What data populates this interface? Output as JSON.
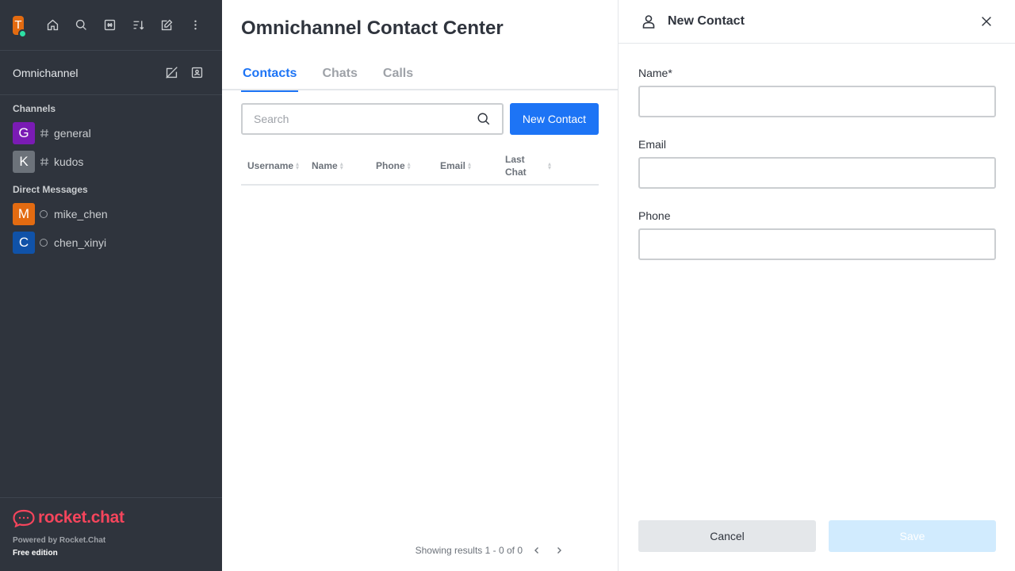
{
  "sidebar": {
    "user_initial": "T",
    "colors": {
      "user_avatar": "#e36b11",
      "status_online": "#2de0a5"
    },
    "top_icons": [
      "home-icon",
      "search-icon",
      "directory-icon",
      "sort-icon",
      "create-new-icon",
      "kebab-menu-icon"
    ],
    "omnichannel_label": "Omnichannel",
    "channels_title": "Channels",
    "channels": [
      {
        "initial": "G",
        "name": "general",
        "color": "#7a1bb4"
      },
      {
        "initial": "K",
        "name": "kudos",
        "color": "#6c727a"
      }
    ],
    "dm_title": "Direct Messages",
    "direct_messages": [
      {
        "initial": "M",
        "name": "mike_chen",
        "color": "#e36b11"
      },
      {
        "initial": "C",
        "name": "chen_xinyi",
        "color": "#1052a8"
      }
    ],
    "footer": {
      "logo_text": "rocket.chat",
      "powered_by": "Powered by Rocket.Chat",
      "edition": "Free edition"
    }
  },
  "main": {
    "title": "Omnichannel Contact Center",
    "tabs": [
      {
        "label": "Contacts",
        "active": true
      },
      {
        "label": "Chats",
        "active": false
      },
      {
        "label": "Calls",
        "active": false
      }
    ],
    "search_placeholder": "Search",
    "new_contact_label": "New Contact",
    "columns": [
      "Username",
      "Name",
      "Phone",
      "Email",
      "Last Chat"
    ],
    "rows": [],
    "pagination_text": "Showing results 1 - 0 of 0",
    "accent_color": "#1d74f5"
  },
  "panel": {
    "title": "New Contact",
    "fields": {
      "name_label": "Name*",
      "name_value": "",
      "email_label": "Email",
      "email_value": "",
      "phone_label": "Phone",
      "phone_value": ""
    },
    "cancel_label": "Cancel",
    "save_label": "Save",
    "save_disabled": true
  }
}
